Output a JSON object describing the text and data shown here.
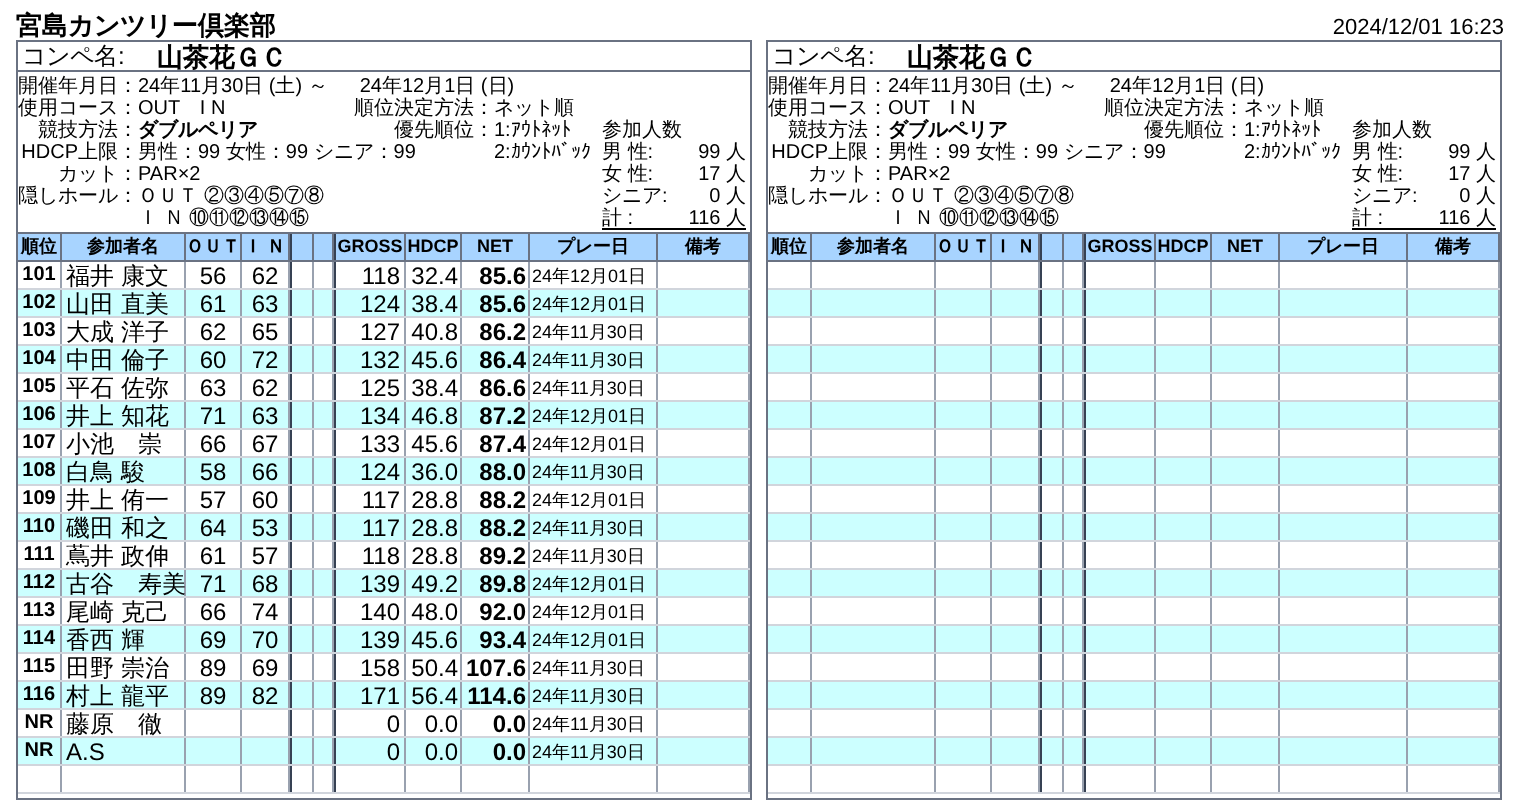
{
  "title": "宮島カンツリー倶楽部",
  "timestamp": "2024/12/01 16:23",
  "panels": [
    {
      "comp_label": "コンペ名:",
      "comp_name": "山茶花ＧＣ",
      "info": {
        "date_label": "開催年月日：",
        "date_from": "24年11月30日 (土) ～",
        "date_to": "24年12月1日 (日)",
        "course_label": "使用コース：",
        "course": "OUT　I N",
        "ranking_label": "順位決定方法：",
        "ranking": "ネット順",
        "format_label": "競技方法：",
        "format": "ダブルペリア",
        "priority_label": "優先順位：",
        "priority": [
          "1:ｱｳﾄﾈｯﾄ",
          "2:ｶｳﾝﾄﾊﾞｯｸ"
        ],
        "hdcp_label": "HDCP上限：",
        "hdcp": "男性：99 女性：99 シニア：99",
        "cut_label": "カット：",
        "cut": "PAR×2",
        "hidden_label": "隠しホール：",
        "hidden": [
          "ＯＵＴ ②③④⑤⑦⑧",
          "Ｉ Ｎ ⑩⑪⑫⑬⑭⑮"
        ]
      },
      "participants": {
        "title": "参加人数",
        "rows": [
          {
            "label": "男 性:",
            "value": "99 人"
          },
          {
            "label": "女 性:",
            "value": "17 人"
          },
          {
            "label": "シニア:",
            "value": "0 人"
          },
          {
            "label": "計 :",
            "value": "116 人"
          }
        ]
      },
      "columns": [
        "順位",
        "参加者名",
        "ＯＵＴ",
        "Ｉ Ｎ",
        "GROSS",
        "HDCP",
        "NET",
        "プレー日",
        "備考"
      ],
      "rows": [
        {
          "rank": "101",
          "name": "福井 康文",
          "out": "56",
          "in": "62",
          "gross": "118",
          "hdcp": "32.4",
          "net": "85.6",
          "play_date": "24年12月01日"
        },
        {
          "rank": "102",
          "name": "山田 直美",
          "out": "61",
          "in": "63",
          "gross": "124",
          "hdcp": "38.4",
          "net": "85.6",
          "play_date": "24年12月01日"
        },
        {
          "rank": "103",
          "name": "大成 洋子",
          "out": "62",
          "in": "65",
          "gross": "127",
          "hdcp": "40.8",
          "net": "86.2",
          "play_date": "24年11月30日"
        },
        {
          "rank": "104",
          "name": "中田 倫子",
          "out": "60",
          "in": "72",
          "gross": "132",
          "hdcp": "45.6",
          "net": "86.4",
          "play_date": "24年11月30日"
        },
        {
          "rank": "105",
          "name": "平石 佐弥",
          "out": "63",
          "in": "62",
          "gross": "125",
          "hdcp": "38.4",
          "net": "86.6",
          "play_date": "24年11月30日"
        },
        {
          "rank": "106",
          "name": "井上 知花",
          "out": "71",
          "in": "63",
          "gross": "134",
          "hdcp": "46.8",
          "net": "87.2",
          "play_date": "24年12月01日"
        },
        {
          "rank": "107",
          "name": "小池　崇",
          "out": "66",
          "in": "67",
          "gross": "133",
          "hdcp": "45.6",
          "net": "87.4",
          "play_date": "24年12月01日"
        },
        {
          "rank": "108",
          "name": "白鳥 駿",
          "out": "58",
          "in": "66",
          "gross": "124",
          "hdcp": "36.0",
          "net": "88.0",
          "play_date": "24年11月30日"
        },
        {
          "rank": "109",
          "name": "井上 侑一",
          "out": "57",
          "in": "60",
          "gross": "117",
          "hdcp": "28.8",
          "net": "88.2",
          "play_date": "24年12月01日"
        },
        {
          "rank": "110",
          "name": "磯田 和之",
          "out": "64",
          "in": "53",
          "gross": "117",
          "hdcp": "28.8",
          "net": "88.2",
          "play_date": "24年11月30日"
        },
        {
          "rank": "111",
          "name": "蔦井 政伸",
          "out": "61",
          "in": "57",
          "gross": "118",
          "hdcp": "28.8",
          "net": "89.2",
          "play_date": "24年11月30日"
        },
        {
          "rank": "112",
          "name": "古谷　寿美",
          "out": "71",
          "in": "68",
          "gross": "139",
          "hdcp": "49.2",
          "net": "89.8",
          "play_date": "24年12月01日"
        },
        {
          "rank": "113",
          "name": "尾崎 克己",
          "out": "66",
          "in": "74",
          "gross": "140",
          "hdcp": "48.0",
          "net": "92.0",
          "play_date": "24年12月01日"
        },
        {
          "rank": "114",
          "name": "香西 輝",
          "out": "69",
          "in": "70",
          "gross": "139",
          "hdcp": "45.6",
          "net": "93.4",
          "play_date": "24年12月01日"
        },
        {
          "rank": "115",
          "name": "田野 崇治",
          "out": "89",
          "in": "69",
          "gross": "158",
          "hdcp": "50.4",
          "net": "107.6",
          "play_date": "24年11月30日"
        },
        {
          "rank": "116",
          "name": "村上 龍平",
          "out": "89",
          "in": "82",
          "gross": "171",
          "hdcp": "56.4",
          "net": "114.6",
          "play_date": "24年11月30日"
        },
        {
          "rank": "NR",
          "name": "藤原　徹",
          "gross": "0",
          "hdcp": "0.0",
          "net": "0.0",
          "play_date": "24年11月30日"
        },
        {
          "rank": "NR",
          "name": "A.S",
          "gross": "0",
          "hdcp": "0.0",
          "net": "0.0",
          "play_date": "24年11月30日"
        }
      ]
    },
    {
      "comp_label": "コンペ名:",
      "comp_name": "山茶花ＧＣ",
      "info": {
        "date_label": "開催年月日：",
        "date_from": "24年11月30日 (土) ～",
        "date_to": "24年12月1日 (日)",
        "course_label": "使用コース：",
        "course": "OUT　I N",
        "ranking_label": "順位決定方法：",
        "ranking": "ネット順",
        "format_label": "競技方法：",
        "format": "ダブルペリア",
        "priority_label": "優先順位：",
        "priority": [
          "1:ｱｳﾄﾈｯﾄ",
          "2:ｶｳﾝﾄﾊﾞｯｸ"
        ],
        "hdcp_label": "HDCP上限：",
        "hdcp": "男性：99 女性：99 シニア：99",
        "cut_label": "カット：",
        "cut": "PAR×2",
        "hidden_label": "隠しホール：",
        "hidden": [
          "ＯＵＴ ②③④⑤⑦⑧",
          "Ｉ Ｎ ⑩⑪⑫⑬⑭⑮"
        ]
      },
      "participants": {
        "title": "参加人数",
        "rows": [
          {
            "label": "男 性:",
            "value": "99 人"
          },
          {
            "label": "女 性:",
            "value": "17 人"
          },
          {
            "label": "シニア:",
            "value": "0 人"
          },
          {
            "label": "計 :",
            "value": "116 人"
          }
        ]
      },
      "columns": [
        "順位",
        "参加者名",
        "ＯＵＴ",
        "Ｉ Ｎ",
        "GROSS",
        "HDCP",
        "NET",
        "プレー日",
        "備考"
      ]
    }
  ]
}
